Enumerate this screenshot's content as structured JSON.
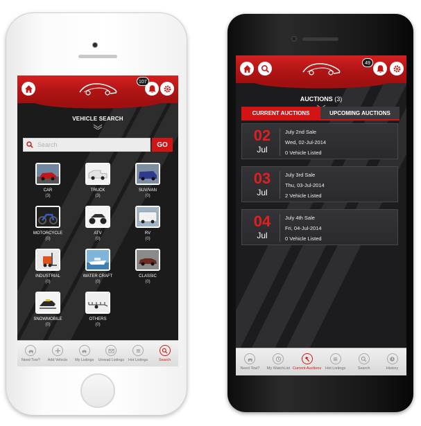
{
  "iphone": {
    "header": {
      "badge_count": "107"
    },
    "title": "VEHICLE SEARCH",
    "search": {
      "placeholder": "Search",
      "go_label": "GO"
    },
    "categories": [
      {
        "name": "CAR",
        "count": "(3)",
        "icon": "car-icon"
      },
      {
        "name": "TRUCK",
        "count": "(3)",
        "icon": "truck-icon"
      },
      {
        "name": "SUV/VAN",
        "count": "(0)",
        "icon": "van-icon"
      },
      {
        "name": "MOTORCYCLE",
        "count": "(0)",
        "icon": "motorcycle-icon"
      },
      {
        "name": "ATV",
        "count": "(0)",
        "icon": "atv-icon"
      },
      {
        "name": "RV",
        "count": "(0)",
        "icon": "rv-icon"
      },
      {
        "name": "INDUSTRIAL",
        "count": "(0)",
        "icon": "forklift-icon"
      },
      {
        "name": "WATER CRAFT",
        "count": "(0)",
        "icon": "boat-icon"
      },
      {
        "name": "CLASSIC",
        "count": "(0)",
        "icon": "classic-car-icon"
      },
      {
        "name": "SNOWMOBILE",
        "count": "(0)",
        "icon": "snowmobile-icon"
      },
      {
        "name": "OTHERS",
        "count": "(0)",
        "icon": "trailer-icon"
      }
    ],
    "tabs": [
      {
        "label": "Need Tow?",
        "icon": "tow-icon"
      },
      {
        "label": "Add Vehicle",
        "icon": "plus-icon"
      },
      {
        "label": "My Listings",
        "icon": "car-icon"
      },
      {
        "label": "Unread Listings",
        "icon": "mail-icon"
      },
      {
        "label": "Hot Listings",
        "icon": "list-icon"
      },
      {
        "label": "Search",
        "icon": "search-icon",
        "active": true
      }
    ]
  },
  "android": {
    "header": {
      "badge_count": "49"
    },
    "title": "AUCTIONS",
    "title_count": "(3)",
    "segments": {
      "current": "CURRENT AUCTIONS",
      "upcoming": "UPCOMING AUCTIONS"
    },
    "auctions": [
      {
        "day": "02",
        "month": "Jul",
        "name": "July 2nd Sale",
        "date": "Wed, 02-Jul-2014",
        "listed": "0 Vehicle Listed"
      },
      {
        "day": "03",
        "month": "Jul",
        "name": "July 3rd Sale",
        "date": "Thu, 03-Jul-2014",
        "listed": "2 Vehicle Listed"
      },
      {
        "day": "04",
        "month": "Jul",
        "name": "July 4th Sale",
        "date": "Fri, 04-Jul-2014",
        "listed": "0 Vehicle Listed"
      }
    ],
    "tabs": [
      {
        "label": "Need Tow?",
        "icon": "tow-icon"
      },
      {
        "label": "My WatchList",
        "icon": "clock-icon"
      },
      {
        "label": "Current Auctions",
        "icon": "gavel-icon",
        "active": true
      },
      {
        "label": "Hot Listings",
        "icon": "list-icon"
      },
      {
        "label": "Search",
        "icon": "search-icon"
      },
      {
        "label": "History",
        "icon": "history-icon"
      }
    ]
  },
  "colors": {
    "brand_red": "#d21414",
    "screen_bg": "#1b1b1b"
  }
}
